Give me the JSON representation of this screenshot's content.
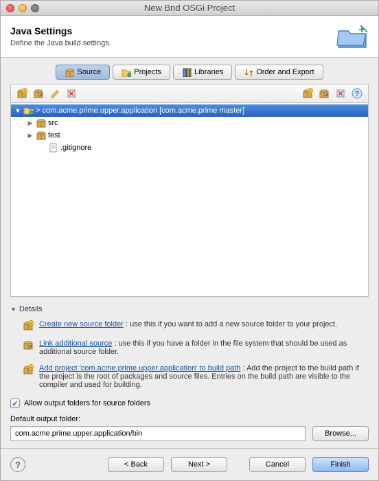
{
  "window": {
    "title": "New Bnd OSGi Project"
  },
  "header": {
    "title": "Java Settings",
    "subtitle": "Define the Java build settings."
  },
  "tabs": {
    "source": "Source",
    "projects": "Projects",
    "libraries": "Libraries",
    "order": "Order and Export"
  },
  "tree": {
    "root_prefix": "> ",
    "root_name": "com.acme.prime.upper.application",
    "root_suffix": "  [com.acme.prime master]",
    "src": "src",
    "test": "test",
    "gitignore": ".gitignore"
  },
  "details": {
    "heading": "Details",
    "create_link": "Create new source folder",
    "create_rest": " : use this if you want to add a new source folder to your project.",
    "link_link": "Link additional source",
    "link_rest": " : use this if you have a folder in the file system that should be used as additional source folder.",
    "add_link": "Add project 'com.acme.prime.upper.application' to build path",
    "add_rest": " : Add the project to the build path if the project is the root of packages and source files. Entries on the build path are visible to the compiler and used for building."
  },
  "allow_output": "Allow output folders for source folders",
  "default_out_label": "Default output folder:",
  "default_out_value": "com.acme.prime.upper.application/bin",
  "buttons": {
    "browse": "Browse...",
    "back": "< Back",
    "next": "Next >",
    "cancel": "Cancel",
    "finish": "Finish"
  }
}
